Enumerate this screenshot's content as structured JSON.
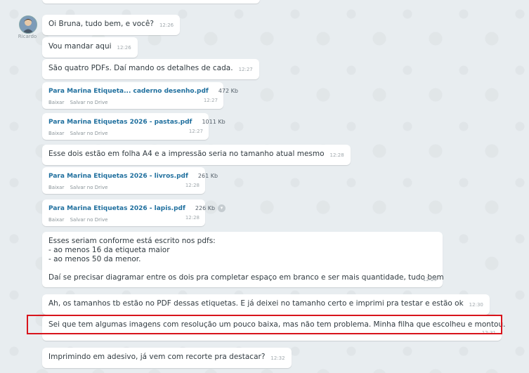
{
  "sender": {
    "name": "Ricardo"
  },
  "messages": [
    {
      "text": "Oi Bruna, tudo bem, e você?",
      "time": "12:26"
    },
    {
      "text": "Vou mandar aqui",
      "time": "12:26"
    },
    {
      "text": "São quatro PDFs. Daí mando os detalhes de cada.",
      "time": "12:27"
    },
    {
      "text": "Esse dois estão em folha A4 e a impressão seria no tamanho atual mesmo",
      "time": "12:28"
    },
    {
      "lines": [
        "Esses seriam conforme está escrito nos pdfs:",
        "- ao menos 16 da etiqueta maior",
        "- ao menos 50 da menor.",
        "",
        "Daí se precisar diagramar entre os dois pra completar espaço em branco e ser mais quantidade, tudo bem"
      ],
      "time": "12:29"
    },
    {
      "text": "Ah, os tamanhos tb estão no PDF dessas etiquetas. E já deixei no tamanho certo e imprimi pra testar e estão ok",
      "time": "12:30"
    },
    {
      "text": "Sei que tem algumas imagens com resolução um pouco baixa, mas não tem problema. Minha filha que escolheu e montou.",
      "time": "12:31"
    },
    {
      "text": "Imprimindo em adesivo, já vem com recorte pra destacar?",
      "time": "12:32"
    }
  ],
  "files": [
    {
      "name": "Para Marina Etiqueta... caderno desenho.pdf",
      "size": "472 Kb",
      "download": "Baixar",
      "drive": "Salvar no Drive",
      "time": "12:27"
    },
    {
      "name": "Para Marina Etiquetas 2026 - pastas.pdf",
      "size": "1011 Kb",
      "download": "Baixar",
      "drive": "Salvar no Drive",
      "time": "12:27"
    },
    {
      "name": "Para Marina Etiquetas 2026 - livros.pdf",
      "size": "261 Kb",
      "download": "Baixar",
      "drive": "Salvar no Drive",
      "time": "12:28"
    },
    {
      "name": "Para Marina Etiquetas 2026 - lapis.pdf",
      "size": "226 Kb",
      "download": "Baixar",
      "drive": "Salvar no Drive",
      "time": "12:28"
    }
  ],
  "colors": {
    "highlight": "#d8141c",
    "link": "#1f6f9e",
    "background": "#e8edf0"
  }
}
